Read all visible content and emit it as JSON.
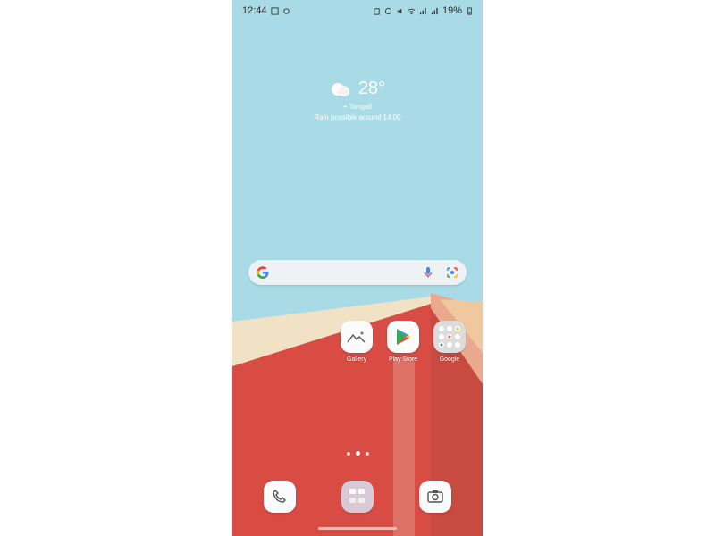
{
  "status_bar": {
    "time": "12:44",
    "battery_percent": "19%"
  },
  "weather": {
    "temperature": "28°",
    "location": "Tangail",
    "forecast": "Rain possible around 14:00"
  },
  "search_bar": {
    "mic_icon": "mic-icon",
    "lens_icon": "lens-icon"
  },
  "apps": [
    {
      "label": "Gallery",
      "icon": "gallery-icon"
    },
    {
      "label": "Play Store",
      "icon": "play-store-icon"
    },
    {
      "label": "Google",
      "icon": "google-folder-icon"
    }
  ],
  "dock": [
    {
      "icon": "phone-icon"
    },
    {
      "icon": "folder-icon"
    },
    {
      "icon": "camera-icon"
    }
  ],
  "colors": {
    "sky": "#a8dbe6",
    "wall_red": "#d84c44",
    "wall_cream": "#f1e2c5"
  }
}
